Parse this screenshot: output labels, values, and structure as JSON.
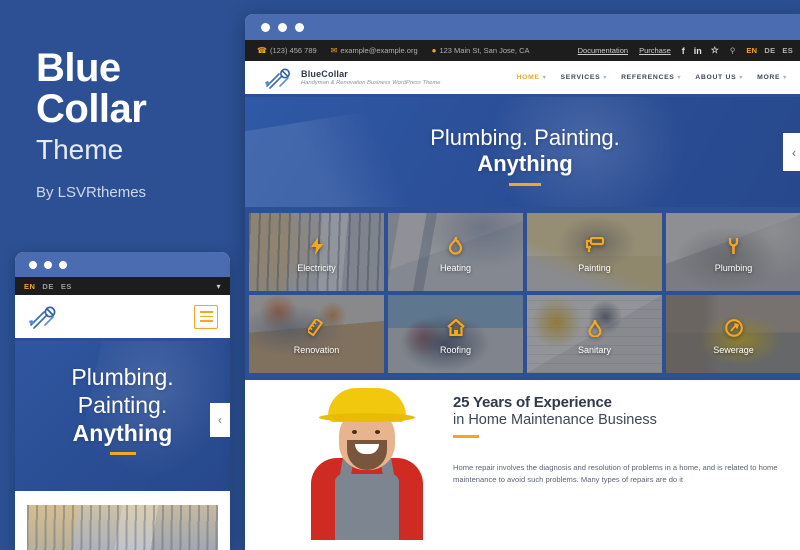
{
  "promo": {
    "title_line1": "Blue",
    "title_line2": "Collar",
    "subtitle": "Theme",
    "author": "By LSVRthemes",
    "background_color": "#2c5093",
    "accent_color": "#f5a623"
  },
  "browser": {
    "dot_label": "window-dots"
  },
  "topbar": {
    "phone_icon": "phone-icon",
    "phone": "(123) 456 789",
    "email_icon": "envelope-icon",
    "email": "example@example.org",
    "address_icon": "map-pin-icon",
    "address": "123 Main St, San Jose, CA",
    "links": [
      "Documentation",
      "Purchase"
    ],
    "socials": [
      "facebook-icon",
      "linkedin-icon",
      "yelp-icon"
    ],
    "search_icon": "search-icon",
    "languages": [
      "EN",
      "DE",
      "ES"
    ],
    "active_language": "EN"
  },
  "header": {
    "logo_icon": "tools-logo-icon",
    "brand_name": "BlueCollar",
    "tagline": "Handyman & Renovation Business WordPress Theme",
    "nav": [
      {
        "label": "HOME",
        "active": true
      },
      {
        "label": "SERVICES",
        "active": false
      },
      {
        "label": "REFERENCES",
        "active": false
      },
      {
        "label": "ABOUT US",
        "active": false
      },
      {
        "label": "MORE",
        "active": false
      }
    ],
    "caret": "˅"
  },
  "hero": {
    "line1": "Plumbing. Painting.",
    "line2": "Anything",
    "prev_arrow": "‹"
  },
  "services": [
    {
      "label": "Electricity",
      "icon": "lightning-bolt-icon",
      "glyph": "⚡",
      "photo": "p-electricity"
    },
    {
      "label": "Heating",
      "icon": "flame-icon",
      "glyph": "🔥",
      "photo": "p-heating"
    },
    {
      "label": "Painting",
      "icon": "paint-roller-icon",
      "glyph": "🖌",
      "photo": "p-painting"
    },
    {
      "label": "Plumbing",
      "icon": "wrench-icon",
      "glyph": "🔧",
      "photo": "p-plumbing"
    },
    {
      "label": "Renovation",
      "icon": "ruler-icon",
      "glyph": "📏",
      "photo": "p-renovation"
    },
    {
      "label": "Roofing",
      "icon": "house-icon",
      "glyph": "🏠",
      "photo": "p-roofing"
    },
    {
      "label": "Sanitary",
      "icon": "water-drop-icon",
      "glyph": "💧",
      "photo": "p-sanitary"
    },
    {
      "label": "Sewerage",
      "icon": "sewer-tool-icon",
      "glyph": "⚙",
      "photo": "p-sewerage"
    }
  ],
  "about": {
    "heading_bold": "25 Years of Experience",
    "heading_light": "in Home Maintenance Business",
    "paragraph": "Home repair involves the diagnosis and resolution of problems in a home, and is related to home maintenance to avoid such problems. Many types of repairs are do it",
    "worker_image": "smiling-handyman-photo"
  },
  "mobile": {
    "languages": [
      "EN",
      "DE",
      "ES"
    ],
    "active_language": "EN",
    "dropdown_icon": "chevron-down-icon",
    "logo_icon": "tools-logo-icon",
    "menu_icon": "hamburger-menu-icon",
    "hero_line1": "Plumbing.",
    "hero_line2": "Painting.",
    "hero_line3": "Anything",
    "prev_arrow": "‹",
    "tile_image": "electricity-service-photo"
  }
}
